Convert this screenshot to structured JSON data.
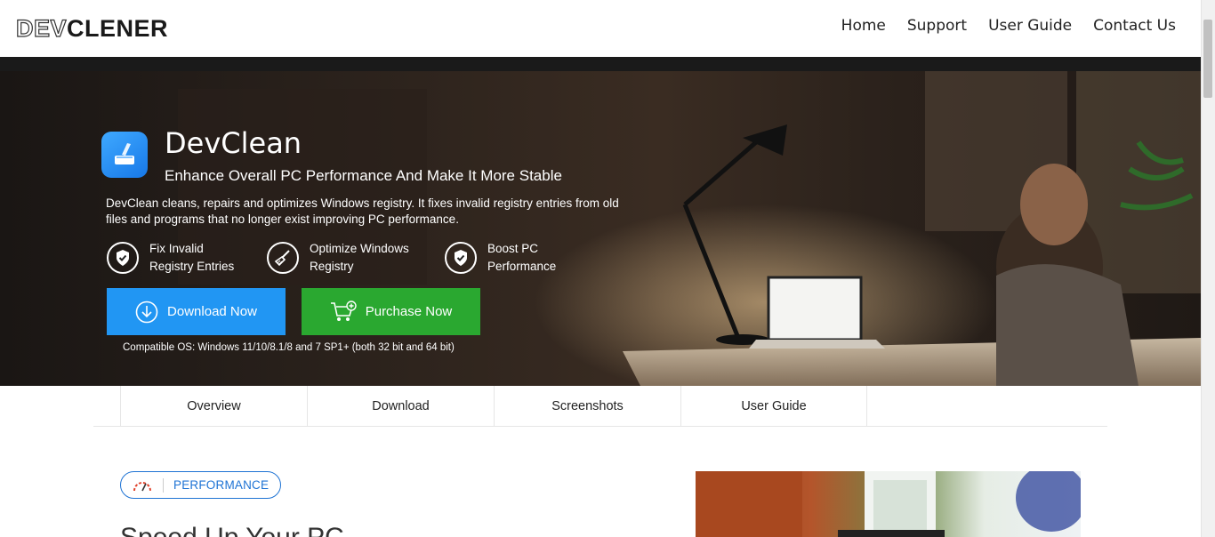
{
  "header": {
    "logo_light": "DEV",
    "logo_dark": "CLENER",
    "nav": [
      "Home",
      "Support",
      "User Guide",
      "Contact Us"
    ]
  },
  "hero": {
    "title": "DevClean",
    "subtitle": "Enhance Overall PC Performance And Make It More Stable",
    "description": "DevClean cleans, repairs and optimizes Windows registry. It fixes invalid registry entries from old files and programs that no longer exist improving PC performance.",
    "features": [
      {
        "line1": "Fix Invalid",
        "line2": "Registry Entries",
        "icon": "shield-check-icon"
      },
      {
        "line1": "Optimize Windows",
        "line2": "Registry",
        "icon": "broom-icon"
      },
      {
        "line1": "Boost PC",
        "line2": "Performance",
        "icon": "shield-check-icon"
      }
    ],
    "download_label": "Download Now",
    "purchase_label": "Purchase Now",
    "compat": "Compatible OS: Windows 11/10/8.1/8 and 7 SP1+ (both 32 bit and 64 bit)"
  },
  "tabs": [
    "Overview",
    "Download",
    "Screenshots",
    "User Guide"
  ],
  "content": {
    "badge": "PERFORMANCE",
    "section_title": "Speed Up Your PC"
  },
  "colors": {
    "download": "#2196f3",
    "purchase": "#2aa830",
    "accent": "#1e73d4"
  }
}
